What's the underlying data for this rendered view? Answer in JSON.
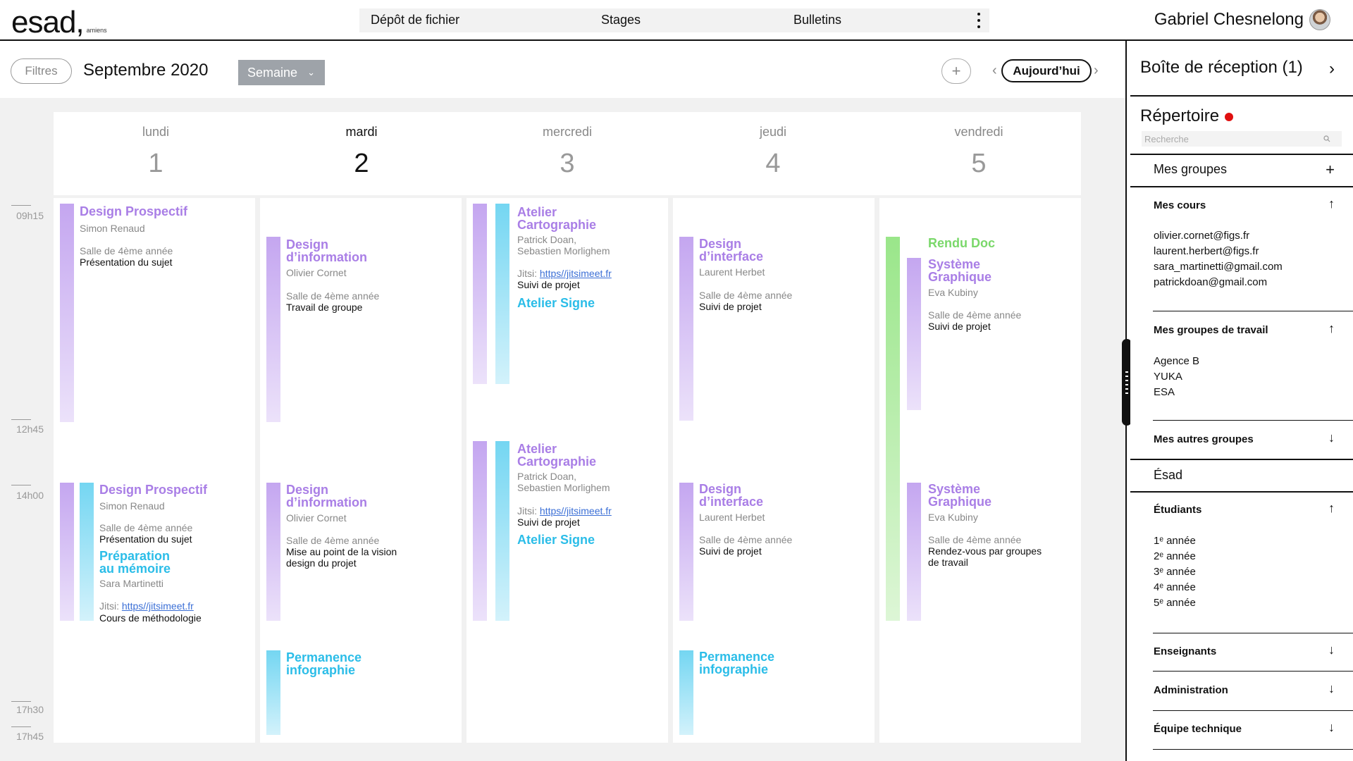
{
  "header": {
    "logo_word": "esad,",
    "logo_city": "amiens",
    "nav": [
      "Dépôt de fichier",
      "Stages",
      "Bulletins"
    ],
    "user_name": "Gabriel Chesnelong"
  },
  "toolbar": {
    "filters_label": "Filtres",
    "month_title": "Septembre 2020",
    "view_label": "Semaine",
    "add_label": "+",
    "today_label": "Aujourd’hui",
    "prev_label": "‹",
    "next_label": "›"
  },
  "calendar": {
    "days": [
      {
        "name": "lundi",
        "num": "1"
      },
      {
        "name": "mardi",
        "num": "2"
      },
      {
        "name": "mercredi",
        "num": "3"
      },
      {
        "name": "jeudi",
        "num": "4"
      },
      {
        "name": "vendredi",
        "num": "5"
      }
    ],
    "times": [
      "09h15",
      "12h45",
      "14h00",
      "17h30",
      "17h45"
    ],
    "events": {
      "mon1": {
        "title": "Design Prospectif",
        "teacher": "Simon Renaud",
        "room": "Salle de 4ème année",
        "desc": "Présentation du sujet"
      },
      "mon2": {
        "title": "Design Prospectif",
        "teacher": "Simon Renaud",
        "room": "Salle de 4ème année",
        "desc": "Présentation du sujet"
      },
      "mon3": {
        "title_l1": "Préparation",
        "title_l2": "au mémoire",
        "teacher": "Sara Martinetti",
        "jitsi_label": "Jitsi:",
        "jitsi_link": "https//jitsimeet.fr",
        "desc": "Cours de méthodologie"
      },
      "tue1": {
        "title_l1": "Design",
        "title_l2": "d’information",
        "teacher": "Olivier Cornet",
        "room": "Salle de 4ème année",
        "desc": "Travail de groupe"
      },
      "tue2": {
        "title_l1": "Design",
        "title_l2": "d’information",
        "teacher": "Olivier Cornet",
        "room": "Salle de 4ème année",
        "desc_l1": "Mise au point de la vision",
        "desc_l2": "design du projet"
      },
      "tue3": {
        "title_l1": "Permanence",
        "title_l2": "infographie"
      },
      "wed1": {
        "title_l1": "Atelier",
        "title_l2": "Cartographie",
        "teacher_l1": "Patrick Doan,",
        "teacher_l2": "Sebastien Morlighem",
        "jitsi_label": "Jitsi:",
        "jitsi_link": "https//jitsimeet.fr",
        "desc": "Suivi de projet"
      },
      "wed2": {
        "title": "Atelier Signe"
      },
      "wed3": {
        "title_l1": "Atelier",
        "title_l2": "Cartographie",
        "teacher_l1": "Patrick Doan,",
        "teacher_l2": "Sebastien Morlighem",
        "jitsi_label": "Jitsi:",
        "jitsi_link": "https//jitsimeet.fr",
        "desc": "Suivi de projet"
      },
      "wed4": {
        "title": "Atelier Signe"
      },
      "thu1": {
        "title_l1": "Design",
        "title_l2": "d’interface",
        "teacher": "Laurent Herbet",
        "room": "Salle de 4ème année",
        "desc": "Suivi de projet"
      },
      "thu2": {
        "title_l1": "Design",
        "title_l2": "d’interface",
        "teacher": "Laurent Herbet",
        "room": "Salle de 4ème année",
        "desc": "Suivi de projet"
      },
      "thu3": {
        "title_l1": "Permanence",
        "title_l2": "infographie"
      },
      "fri1": {
        "title": "Rendu Doc"
      },
      "fri2": {
        "title_l1": "Système",
        "title_l2": "Graphique",
        "teacher": "Eva Kubiny",
        "room": "Salle de 4ème année",
        "desc": "Suivi de projet"
      },
      "fri3": {
        "title_l1": "Système",
        "title_l2": "Graphique",
        "teacher": "Eva Kubiny",
        "room": "Salle de 4ème année",
        "desc_l1": "Rendez-vous par groupes",
        "desc_l2": "de travail"
      }
    }
  },
  "sidebar": {
    "inbox_label": "Boîte de réception (1)",
    "directory_label": "Répertoire",
    "search_placeholder": "Recherche",
    "my_groups": "Mes groupes",
    "my_courses": "Mes cours",
    "course_emails": [
      "olivier.cornet@figs.fr",
      "laurent.herbert@figs.fr",
      "sara_martinetti@gmail.com",
      "patrickdoan@gmail.com"
    ],
    "work_groups": "Mes groupes de travail",
    "work_group_items": [
      "Agence B",
      "YUKA",
      "ESA"
    ],
    "other_groups": "Mes autres groupes",
    "esad": "Ésad",
    "students": "Étudiants",
    "years": [
      "1ᵉ année",
      "2ᵉ année",
      "3ᵉ année",
      "4ᵉ année",
      "5ᵉ année"
    ],
    "teachers": "Enseignants",
    "administration": "Administration",
    "tech_team": "Équipe technique"
  },
  "colors": {
    "purple": "#a97ee6",
    "cyan": "#2bbde8",
    "green": "#7ad86a",
    "notification_dot": "#e01010"
  },
  "icons": [
    "plus-icon",
    "chevron-down-icon",
    "chevron-right-icon",
    "arrow-up-icon",
    "arrow-down-icon",
    "search-icon",
    "kebab-menu-icon"
  ]
}
